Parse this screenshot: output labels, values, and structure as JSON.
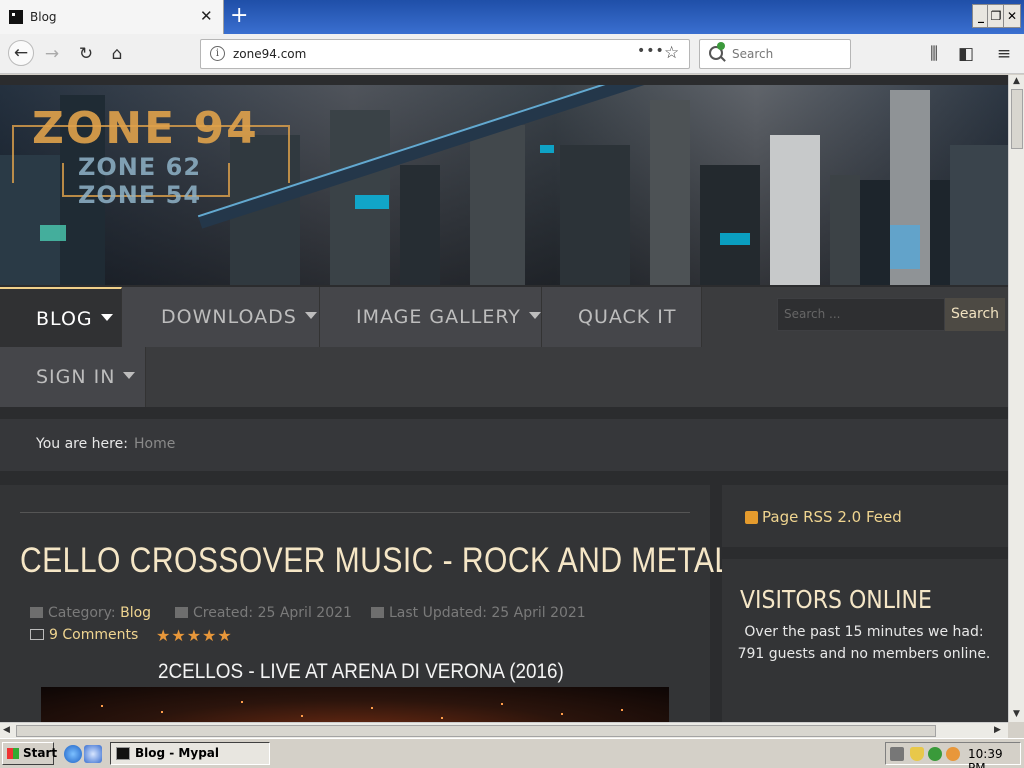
{
  "browser": {
    "tab_title": "Blog",
    "tab_close": "✕",
    "new_tab": "+",
    "url": "zone94.com",
    "url_more": "•••",
    "bookmark_star": "☆",
    "search_placeholder": "Search",
    "window_controls": [
      "_",
      "❐",
      "✕"
    ]
  },
  "site": {
    "logo": {
      "main": "ZONE 94",
      "sub1": "ZONE 62",
      "sub2": "ZONE 54"
    },
    "menu": {
      "items": [
        {
          "label": "BLOG",
          "dropdown": true,
          "active": true
        },
        {
          "label": "DOWNLOADS",
          "dropdown": true
        },
        {
          "label": "IMAGE GALLERY",
          "dropdown": true
        },
        {
          "label": "QUACK IT",
          "dropdown": false
        },
        {
          "label": "SIGN IN",
          "dropdown": true
        }
      ],
      "search_placeholder": "Search ...",
      "search_button": "Search"
    },
    "breadcrumb": {
      "label": "You are here:",
      "home": "Home"
    },
    "article": {
      "title": "CELLO CROSSOVER MUSIC - ROCK AND METAL",
      "category_label": "Category:",
      "category": "Blog",
      "created": "Created: 25 April 2021",
      "updated": "Last Updated: 25 April 2021",
      "comments": "9 Comments",
      "rating": 5,
      "stars": "★★★★★",
      "subheading": "2CELLOS - LIVE AT ARENA DI VERONA (2016)"
    },
    "sidebar": {
      "rss": "Page RSS 2.0 Feed",
      "visitors_heading": "VISITORS ONLINE",
      "visitors_text": "Over the past 15 minutes we had: 791 guests and no members online."
    }
  },
  "taskbar": {
    "start": "Start",
    "task_button": "Blog - Mypal",
    "clock": "10:39 PM"
  }
}
